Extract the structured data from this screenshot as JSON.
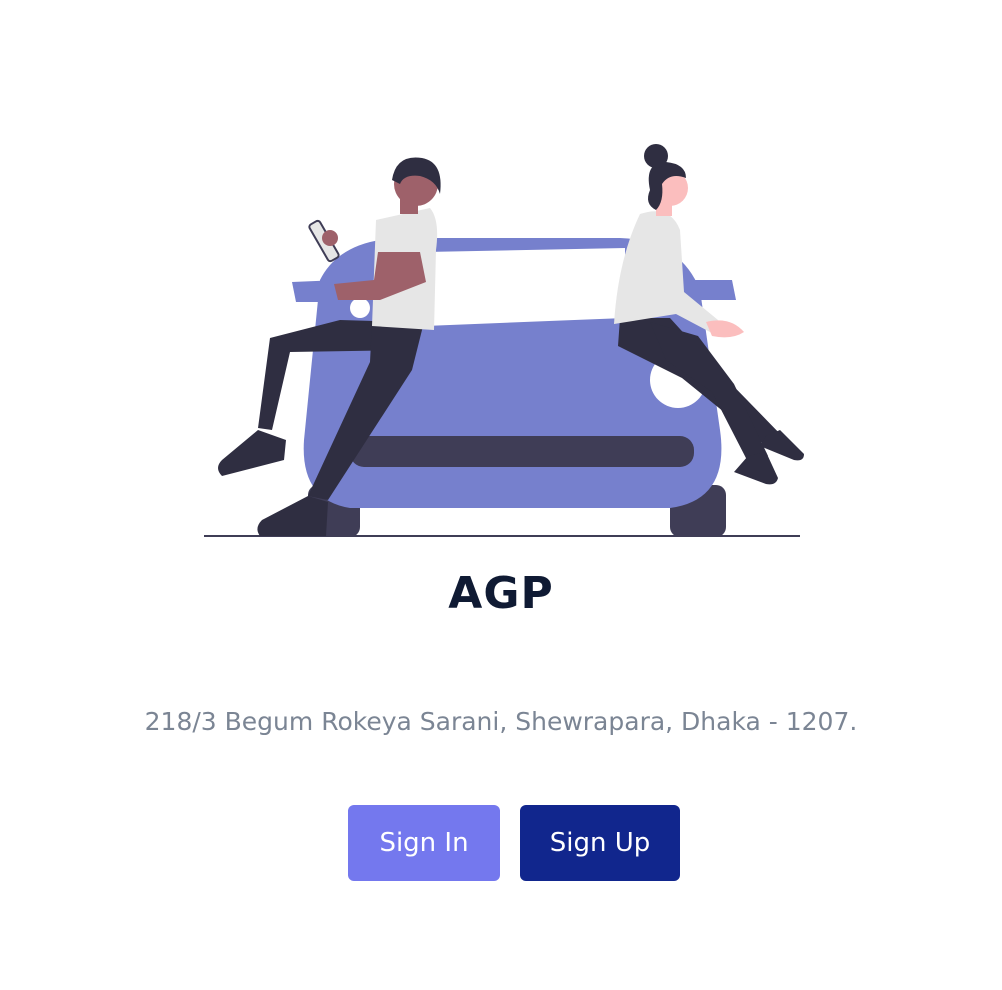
{
  "app": {
    "title": "AGP",
    "address": "218/3 Begum Rokeya Sarani, Shewrapara, Dhaka - 1207."
  },
  "actions": {
    "sign_in_label": "Sign In",
    "sign_up_label": "Sign Up"
  },
  "colors": {
    "sign_in_bg": "#7478ee",
    "sign_up_bg": "#11268d",
    "title": "#0f1a33",
    "address": "#7b8594",
    "car_body": "#7680cd"
  },
  "illustration": {
    "icon": "people-leaning-on-car-illustration"
  }
}
